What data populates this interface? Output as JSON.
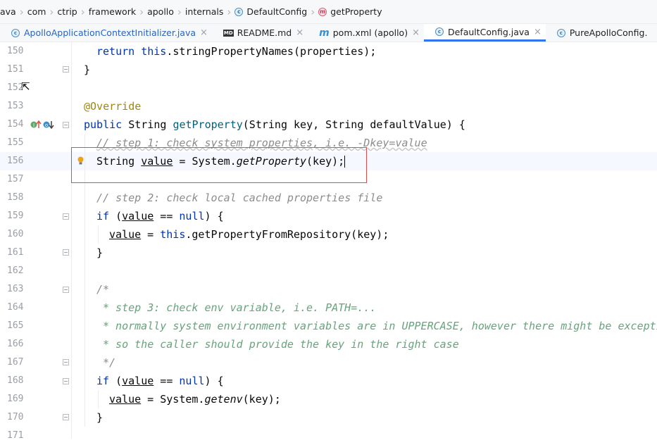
{
  "breadcrumb": {
    "items": [
      "ava",
      "com",
      "ctrip",
      "framework",
      "apollo",
      "internals",
      "DefaultConfig",
      "getProperty"
    ]
  },
  "tabs": [
    {
      "label": "ApolloApplicationContextInitializer.java",
      "close": "×"
    },
    {
      "label": "README.md",
      "close": "×"
    },
    {
      "label": "pom.xml (apollo)",
      "close": "×"
    },
    {
      "label": "DefaultConfig.java",
      "close": "×"
    },
    {
      "label": "PureApolloConfig.",
      "close": ""
    }
  ],
  "editor": {
    "line_numbers": [
      "150",
      "151",
      "152",
      "153",
      "154",
      "155",
      "156",
      "157",
      "158",
      "159",
      "160",
      "161",
      "162",
      "163",
      "164",
      "165",
      "166",
      "167",
      "168",
      "169",
      "170",
      "171"
    ],
    "code": {
      "l150": [
        "return",
        " ",
        "this",
        ".stringPropertyNames(properties);"
      ],
      "l151": "}",
      "l153": "@Override",
      "l154": [
        "public",
        " String ",
        "getProperty",
        "(String key, String defaultValue) {"
      ],
      "l155": "// step 1: check system properties, i.e. -Dkey=value",
      "l156": [
        "String ",
        "value",
        " = System.",
        "getProperty",
        "(key);"
      ],
      "l158": "// step 2: check local cached properties file",
      "l159": [
        "if",
        " (",
        "value",
        " == ",
        "null",
        ") {"
      ],
      "l160": [
        "value",
        " = ",
        "this",
        ".getPropertyFromRepository(key);"
      ],
      "l161": "}",
      "l163": "/*",
      "l164": "* step 3: check env variable, i.e. PATH=...",
      "l165": "* normally system environment variables are in UPPERCASE, however there might be excepti",
      "l166": "* so the caller should provide the key in the right case",
      "l167": "*/",
      "l168": [
        "if",
        " (",
        "value",
        " == ",
        "null",
        ") {"
      ],
      "l169": [
        "value",
        " = System.",
        "getenv",
        "(key);"
      ],
      "l170": "}"
    }
  },
  "colors": {
    "keyword": "#0033b3",
    "annotation": "#9e880d",
    "comment": "#8c8c8c",
    "doc_comment": "#67a37c",
    "highlight_box": "#e04a4a",
    "active_tab_underline": "#3574f0"
  }
}
